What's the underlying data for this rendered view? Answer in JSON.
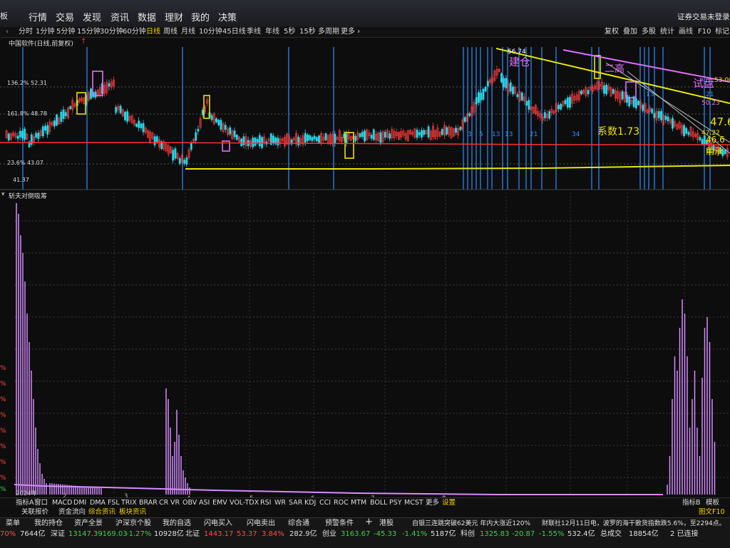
{
  "menu": {
    "left_stub": "板",
    "items": [
      "行情",
      "交易",
      "发现",
      "资讯",
      "数据",
      "理财",
      "我的",
      "决策"
    ],
    "right_status": "证券交易未登录"
  },
  "periods": {
    "items": [
      "分时",
      "1分钟",
      "5分钟",
      "15分钟",
      "30分钟",
      "60分钟",
      "日线",
      "周线",
      "月线",
      "10分钟",
      "45日线",
      "季线",
      "年线",
      "5秒",
      "15秒",
      "多周期",
      "更多 ›"
    ],
    "active": "日线",
    "right_items": [
      "复权",
      "叠加",
      "多股",
      "统计",
      "画线",
      "F10",
      "标记"
    ]
  },
  "chart": {
    "title": "中国软件(日线,前复权)",
    "price_labels": [
      "136.2%  52.31",
      "161.8%  48.78",
      "23.6%  43.07",
      "41.37"
    ],
    "annotations": {
      "build": "建仓",
      "second_high": "二高",
      "try_dip": "试盘",
      "coef": "系数1.73",
      "high_price": "56.74",
      "r1": "53.00",
      "r2": "50.23",
      "r3": "47.22",
      "r4": "47.6",
      "r5": "46.6前",
      "r6": "中承",
      "counts": [
        "3",
        "5",
        "13",
        "13",
        "21",
        "34",
        "21",
        "13"
      ]
    },
    "indicator_title": "斩夫对倒吸筹",
    "xaxis": {
      "year": "2024年",
      "months": [
        "2",
        "3",
        "4",
        "5",
        "6",
        "7",
        "8",
        "9",
        "10",
        "11",
        "12"
      ]
    },
    "left_percent_labels": [
      "%",
      "%",
      "%",
      "%",
      "%",
      "%",
      "%",
      "%",
      "%",
      "2%"
    ]
  },
  "tabs_indicators": [
    "指标A",
    "窗口",
    "MACD",
    "DMI",
    "DMA",
    "FSL",
    "TRIX",
    "BRAR",
    "CR",
    "VR",
    "OBV",
    "ASI",
    "EMV",
    "VOL-TDX",
    "RSI",
    "WR",
    "SAR",
    "KDJ",
    "CCI",
    "ROC",
    "MTM",
    "BOLL",
    "PSY",
    "MCST",
    "更多",
    "设置"
  ],
  "tabs_indicators_active": "设置",
  "tabs_right": [
    "指标B",
    "模板"
  ],
  "info_tabs": [
    "关联报价",
    "资金流向",
    "综合资讯",
    "板块资讯"
  ],
  "info_tabs_active": "综合资讯",
  "info_right": "图文F10  侧",
  "taskbar": {
    "row1": [
      {
        "t": "菜单",
        "c": "wht"
      },
      {
        "t": "我的持仓",
        "c": "wht"
      },
      {
        "t": "资产全景",
        "c": "wht"
      },
      {
        "t": "沪深京个股",
        "c": "wht"
      },
      {
        "t": "我的自选",
        "c": "wht"
      },
      {
        "t": "闪电买入",
        "c": "wht"
      },
      {
        "t": "闪电卖出",
        "c": "wht"
      },
      {
        "t": "综合通",
        "c": "wht"
      },
      {
        "t": "预警条件",
        "c": "wht"
      },
      {
        "t": "+",
        "c": "wht"
      },
      {
        "t": "港股",
        "c": "wht"
      },
      {
        "t": "自银三连跳突破62美元 年内大涨近120%",
        "c": "wht"
      },
      {
        "t": "财联社12月11日电，波罗的海干散货指数跌5.6%，至2294点。",
        "c": "wht"
      }
    ],
    "row2": [
      {
        "t": "70%",
        "c": "red"
      },
      {
        "t": "7644亿",
        "c": "wht"
      },
      {
        "t": "深证",
        "c": "wht"
      },
      {
        "t": "13147.39",
        "c": "grn"
      },
      {
        "t": "-169.03",
        "c": "grn"
      },
      {
        "t": "-1.27%",
        "c": "grn"
      },
      {
        "t": "10928亿",
        "c": "wht"
      },
      {
        "t": "北证",
        "c": "wht"
      },
      {
        "t": "1443.17",
        "c": "red"
      },
      {
        "t": "53.37",
        "c": "red"
      },
      {
        "t": "3.84%",
        "c": "red"
      },
      {
        "t": "282.9亿",
        "c": "wht"
      },
      {
        "t": "创业",
        "c": "wht"
      },
      {
        "t": "3163.67",
        "c": "grn"
      },
      {
        "t": "-45.33",
        "c": "grn"
      },
      {
        "t": "-1.41%",
        "c": "grn"
      },
      {
        "t": "5187亿",
        "c": "wht"
      },
      {
        "t": "科创",
        "c": "wht"
      },
      {
        "t": "1325.83",
        "c": "grn"
      },
      {
        "t": "-20.87",
        "c": "grn"
      },
      {
        "t": "-1.55%",
        "c": "grn"
      },
      {
        "t": "532.4亿",
        "c": "wht"
      },
      {
        "t": "总成交",
        "c": "wht"
      },
      {
        "t": "18854亿",
        "c": "wht"
      },
      {
        "t": "2 已连接",
        "c": "wht"
      }
    ]
  },
  "colors": {
    "up": "#ff3b3b",
    "down": "#27d4e6",
    "yellow": "#f0e000",
    "magenta": "#e070ff",
    "blue_vline": "#2f8fff",
    "bars": "#d58cff"
  }
}
